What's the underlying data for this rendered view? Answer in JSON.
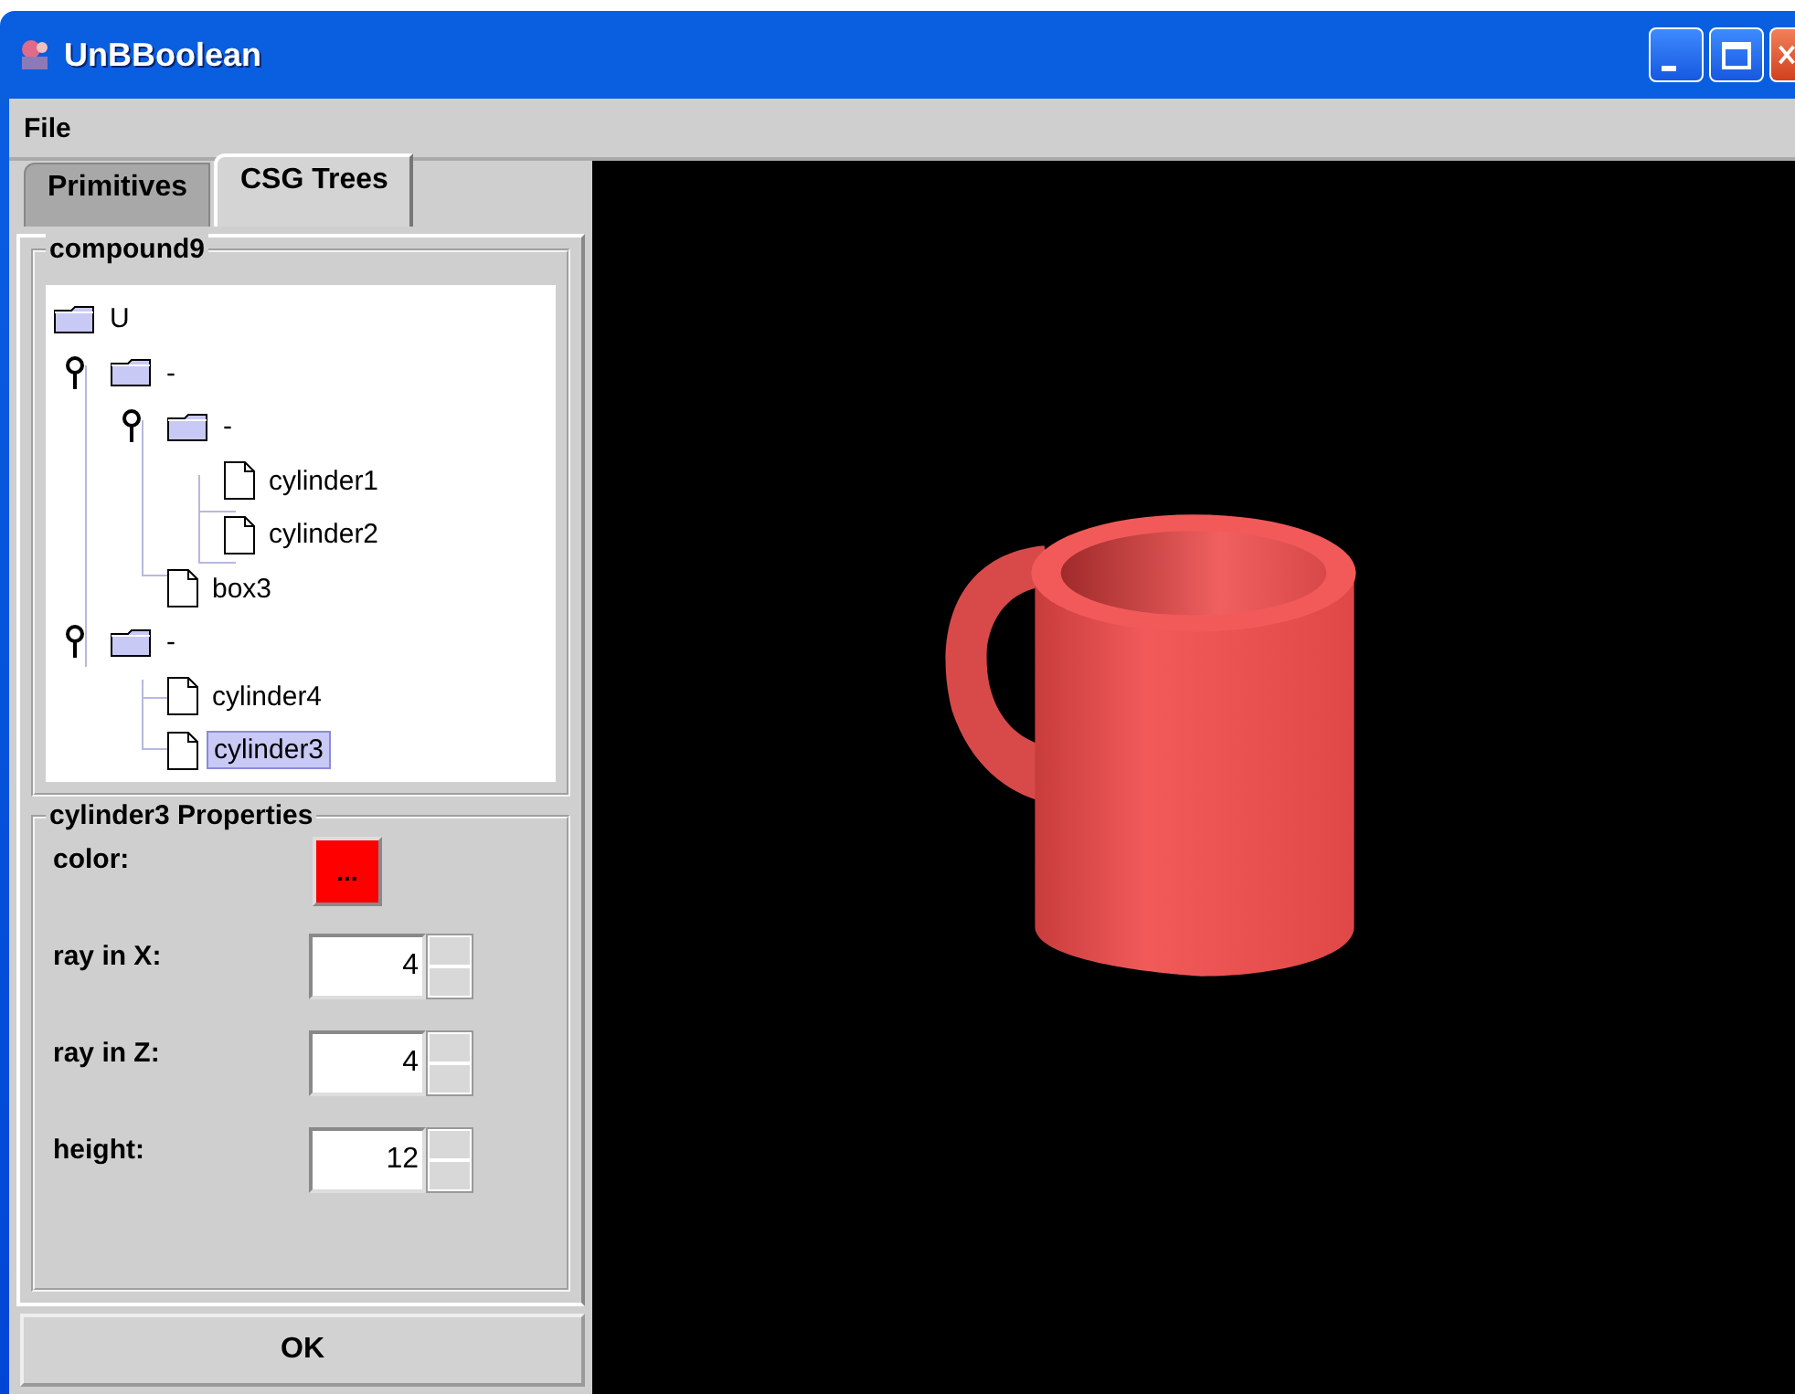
{
  "window": {
    "title": "UnBBoolean"
  },
  "menu": [
    "File"
  ],
  "tabs": [
    {
      "label": "Primitives",
      "selected": false
    },
    {
      "label": "CSG Trees",
      "selected": true
    }
  ],
  "tree": {
    "title": "compound9",
    "root": {
      "label": "U",
      "kind": "folder",
      "selected": false,
      "children": [
        {
          "label": "-",
          "kind": "folder",
          "expanded": true,
          "selected": false,
          "children": [
            {
              "label": "-",
              "kind": "folder",
              "expanded": true,
              "selected": false,
              "children": [
                {
                  "label": "cylinder1",
                  "kind": "file",
                  "selected": false
                },
                {
                  "label": "cylinder2",
                  "kind": "file",
                  "selected": false
                }
              ]
            },
            {
              "label": "box3",
              "kind": "file",
              "selected": false
            }
          ]
        },
        {
          "label": "-",
          "kind": "folder",
          "expanded": true,
          "selected": false,
          "children": [
            {
              "label": "cylinder4",
              "kind": "file",
              "selected": false
            },
            {
              "label": "cylinder3",
              "kind": "file",
              "selected": true
            }
          ]
        }
      ]
    }
  },
  "properties": {
    "title": "cylinder3 Properties",
    "rows": [
      {
        "label": "color:",
        "kind": "color",
        "color": "#ff0000",
        "button": "..."
      },
      {
        "label": "ray in X:",
        "kind": "number",
        "value": "4"
      },
      {
        "label": "ray in Z:",
        "kind": "number",
        "value": "4"
      },
      {
        "label": "height:",
        "kind": "number",
        "value": "12"
      }
    ]
  },
  "ok_button": "OK"
}
